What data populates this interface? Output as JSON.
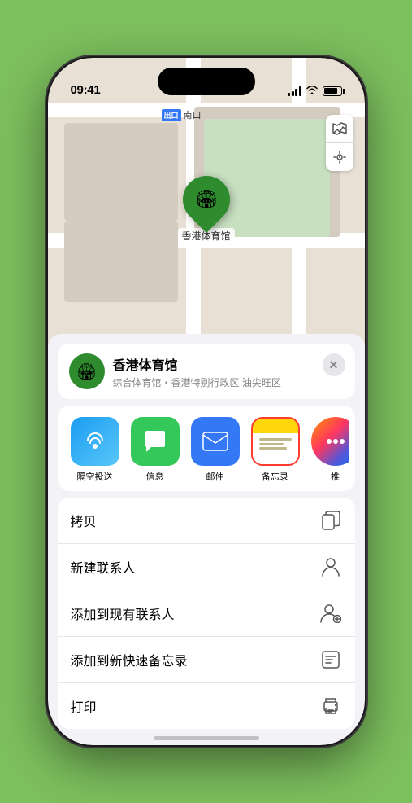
{
  "status_bar": {
    "time": "09:41",
    "location_arrow": "▶"
  },
  "map": {
    "south_label_badge": "出口",
    "south_label_text": "南口",
    "pin_label": "香港体育馆",
    "controls": {
      "map_icon": "🗺",
      "location_icon": "➤"
    }
  },
  "location_card": {
    "name": "香港体育馆",
    "subtitle": "综合体育馆・香港特别行政区 油尖旺区",
    "close": "✕"
  },
  "share_apps": [
    {
      "id": "airdrop",
      "label": "隔空投送",
      "icon_type": "airdrop"
    },
    {
      "id": "messages",
      "label": "信息",
      "icon_type": "messages"
    },
    {
      "id": "mail",
      "label": "邮件",
      "icon_type": "mail"
    },
    {
      "id": "notes",
      "label": "备忘录",
      "icon_type": "notes"
    },
    {
      "id": "more",
      "label": "推",
      "icon_type": "more"
    }
  ],
  "actions": [
    {
      "id": "copy",
      "label": "拷贝",
      "icon": "copy"
    },
    {
      "id": "new-contact",
      "label": "新建联系人",
      "icon": "person"
    },
    {
      "id": "add-existing",
      "label": "添加到现有联系人",
      "icon": "person-add"
    },
    {
      "id": "add-notes",
      "label": "添加到新快速备忘录",
      "icon": "note"
    },
    {
      "id": "print",
      "label": "打印",
      "icon": "print"
    }
  ]
}
